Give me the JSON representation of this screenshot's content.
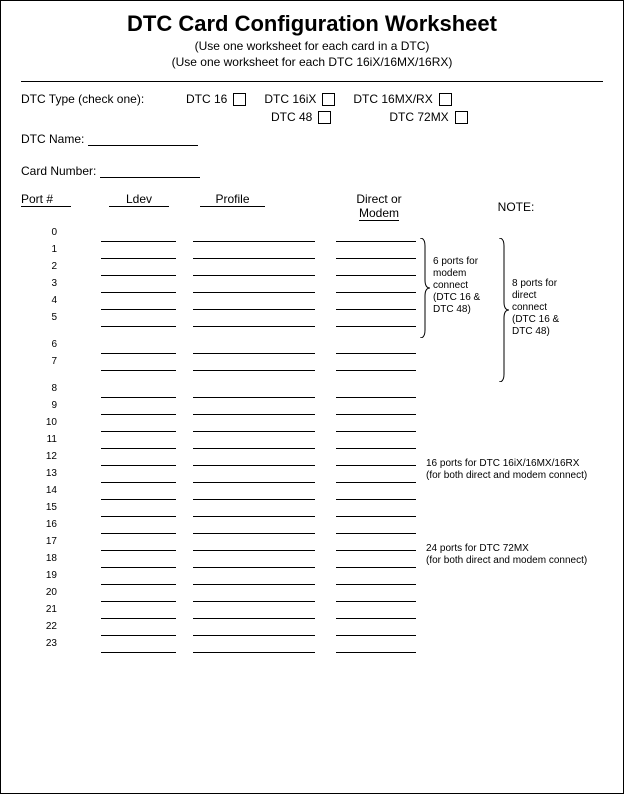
{
  "header": {
    "title": "DTC Card Configuration Worksheet",
    "subtitle1": "(Use one worksheet for each card in a DTC)",
    "subtitle2": "(Use one worksheet for each DTC 16iX/16MX/16RX)"
  },
  "dtc_type": {
    "label": "DTC Type (check one):",
    "options_row1": [
      "DTC 16",
      "DTC 16iX",
      "DTC 16MX/RX"
    ],
    "options_row2": [
      "DTC 48",
      "DTC 72MX"
    ]
  },
  "dtc_name_label": "DTC Name:",
  "card_number_label": "Card Number:",
  "columns": {
    "port": "Port #",
    "ldev": "Ldev",
    "profile": "Profile",
    "direct_or": "Direct or",
    "modem": "Modem",
    "note": "NOTE:"
  },
  "ports": [
    "0",
    "1",
    "2",
    "3",
    "4",
    "5",
    "6",
    "7",
    "8",
    "9",
    "10",
    "11",
    "12",
    "13",
    "14",
    "15",
    "16",
    "17",
    "18",
    "19",
    "20",
    "21",
    "22",
    "23"
  ],
  "notes": {
    "n1": "6 ports for\nmodem\nconnect\n(DTC 16 &\nDTC 48)",
    "n2": "8 ports for\ndirect\nconnect\n(DTC 16 &\nDTC 48)",
    "n3a": "16 ports for DTC 16iX/16MX/16RX",
    "n3b": "(for both direct and modem connect)",
    "n4a": "24 ports for DTC 72MX",
    "n4b": "(for both direct and modem connect)"
  }
}
